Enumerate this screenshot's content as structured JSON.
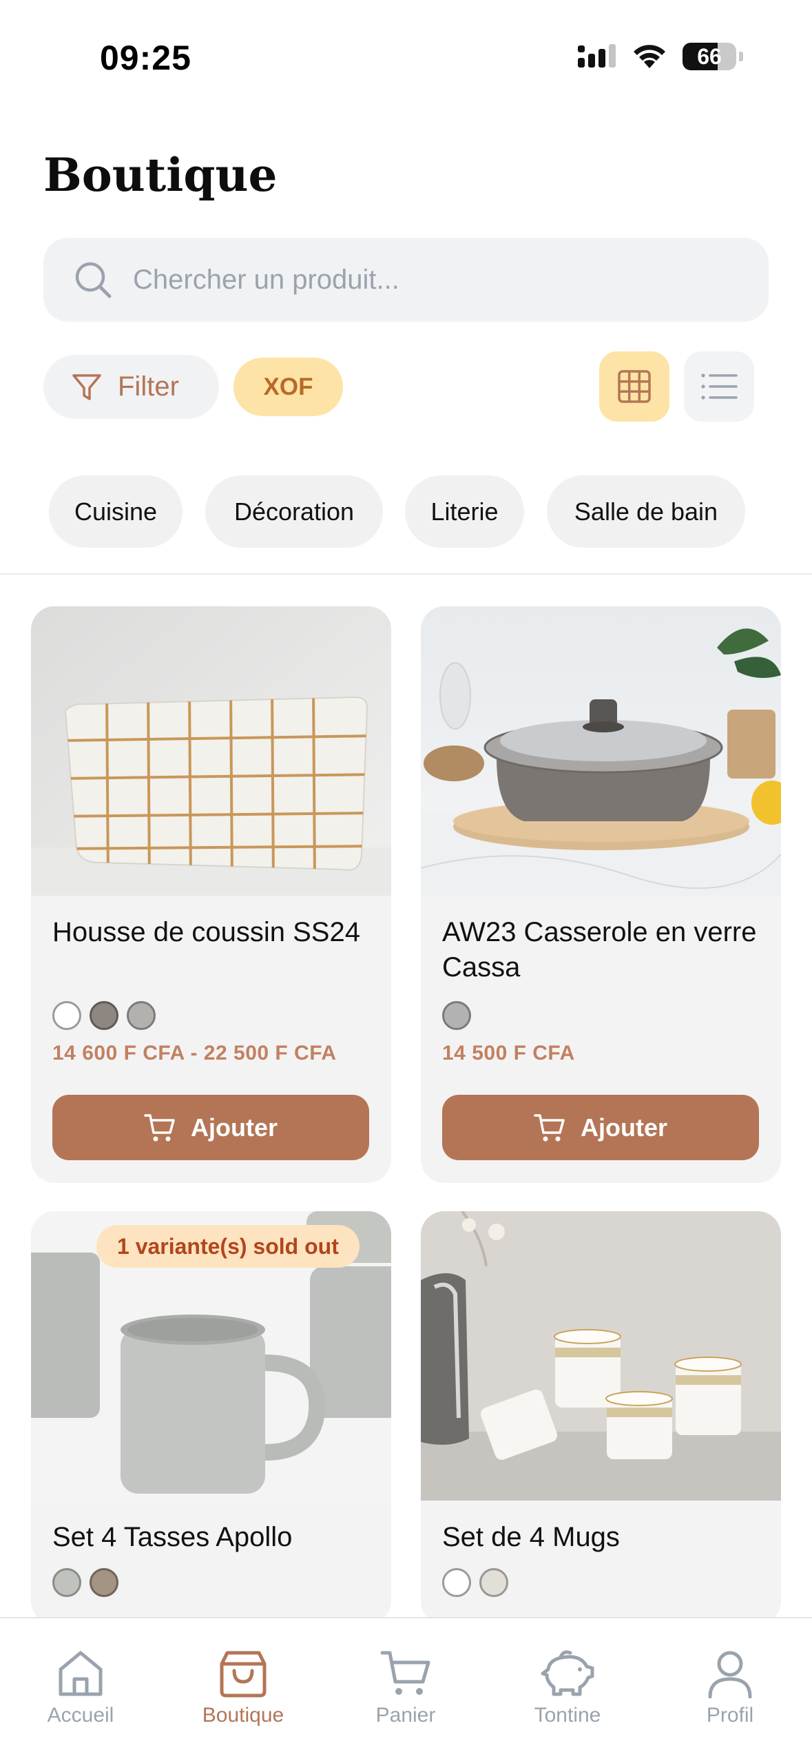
{
  "status_bar": {
    "time": "09:25",
    "battery": "66",
    "battery_level": 0.66
  },
  "page": {
    "title": "Boutique"
  },
  "search": {
    "placeholder": "Chercher un produit..."
  },
  "toolbar": {
    "filter_label": "Filter",
    "currency": "XOF",
    "active_view": "grid"
  },
  "categories": [
    "Cuisine",
    "Décoration",
    "Literie",
    "Salle de bain"
  ],
  "products": [
    {
      "title": "Housse de coussin SS24",
      "swatches": [
        "#ffffff",
        "#8e8781",
        "#b3b1ae"
      ],
      "price": "14 600 F CFA - 22 500 F CFA",
      "button_label": "Ajouter"
    },
    {
      "title": "AW23 Casserole en verre Cassa",
      "swatches": [
        "#b2b2b2"
      ],
      "price": "14 500 F CFA",
      "button_label": "Ajouter"
    },
    {
      "title": "Set 4 Tasses Apollo",
      "badge": "1 variante(s) sold out",
      "swatches": [
        "#c0c2bd",
        "#a39483"
      ]
    },
    {
      "title": "Set de 4 Mugs",
      "swatches": [
        "#ffffff",
        "#e2ded8"
      ]
    }
  ],
  "nav": [
    {
      "label": "Accueil",
      "icon": "home-icon"
    },
    {
      "label": "Boutique",
      "icon": "shopping-bag-icon",
      "active": true
    },
    {
      "label": "Panier",
      "icon": "cart-icon"
    },
    {
      "label": "Tontine",
      "icon": "piggy-bank-icon"
    },
    {
      "label": "Profil",
      "icon": "user-icon"
    }
  ],
  "colors": {
    "accent": "#b47556",
    "chip_yellow": "#fde3a6",
    "price": "#c28060",
    "surface": "#f3f3f4"
  }
}
